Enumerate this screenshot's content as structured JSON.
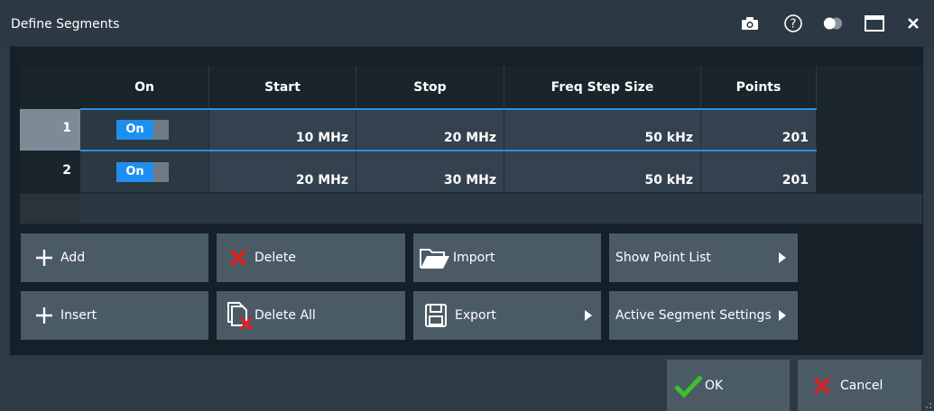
{
  "window": {
    "title": "Define Segments"
  },
  "titlebar_icons": [
    "camera-icon",
    "help-icon",
    "toggle-theme-icon",
    "maximize-icon",
    "close-icon"
  ],
  "table": {
    "columns": [
      "On",
      "Start",
      "Stop",
      "Freq Step Size",
      "Points"
    ],
    "rows": [
      {
        "index": "1",
        "on": "On",
        "start": "10 MHz",
        "stop": "20 MHz",
        "step": "50 kHz",
        "points": "201"
      },
      {
        "index": "2",
        "on": "On",
        "start": "20 MHz",
        "stop": "30 MHz",
        "step": "50 kHz",
        "points": "201"
      }
    ]
  },
  "buttons": {
    "add": "Add",
    "insert": "Insert",
    "delete": "Delete",
    "delete_all": "Delete All",
    "import": "Import",
    "export": "Export",
    "show_point_list": "Show Point List",
    "active_segment_settings": "Active Segment Settings",
    "ok": "OK",
    "cancel": "Cancel"
  },
  "colors": {
    "accent": "#1f8ef1",
    "ok_green": "#3fbf2f",
    "cancel_red": "#e02020"
  }
}
